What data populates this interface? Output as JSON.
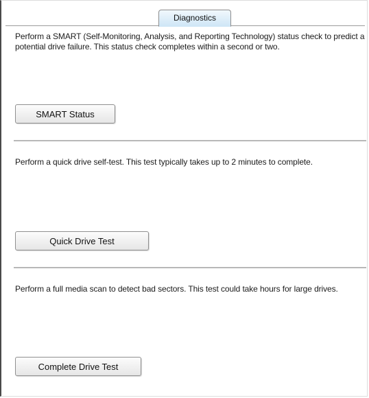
{
  "tab": {
    "label": "Diagnostics"
  },
  "sections": [
    {
      "description": "Perform a SMART (Self-Monitoring, Analysis, and Reporting Technology) status check to predict a potential drive failure. This status check completes within a second or two.",
      "button_label": "SMART Status"
    },
    {
      "description": "Perform a quick drive self-test. This test typically takes up to 2 minutes to complete.",
      "button_label": "Quick Drive Test"
    },
    {
      "description": "Perform a full media scan to detect bad sectors. This test could take hours for large drives.",
      "button_label": "Complete Drive Test"
    }
  ]
}
